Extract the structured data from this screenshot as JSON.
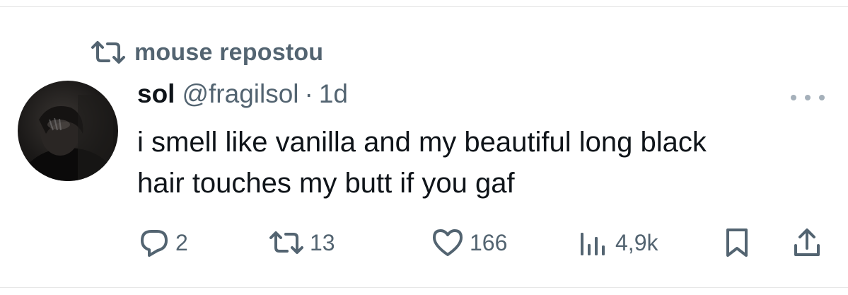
{
  "repost": {
    "text": "mouse repostou",
    "icon": "repost-icon"
  },
  "tweet": {
    "display_name": "sol",
    "handle": "@fragilsol",
    "separator": "·",
    "time": "1d",
    "text_lines": [
      "i smell like vanilla and my beautiful long black",
      "hair touches my butt if you gaf"
    ]
  },
  "actions": {
    "reply": {
      "icon": "reply-icon",
      "count": "2"
    },
    "repost": {
      "icon": "repost-icon",
      "count": "13"
    },
    "like": {
      "icon": "heart-icon",
      "count": "166"
    },
    "views": {
      "icon": "views-icon",
      "count": "4,9k"
    },
    "bookmark": {
      "icon": "bookmark-icon"
    },
    "share": {
      "icon": "share-icon"
    }
  },
  "colors": {
    "text_primary": "#0f1419",
    "text_secondary": "#536471",
    "divider": "#e6e6e6",
    "more_dots": "#a5b0ba"
  }
}
